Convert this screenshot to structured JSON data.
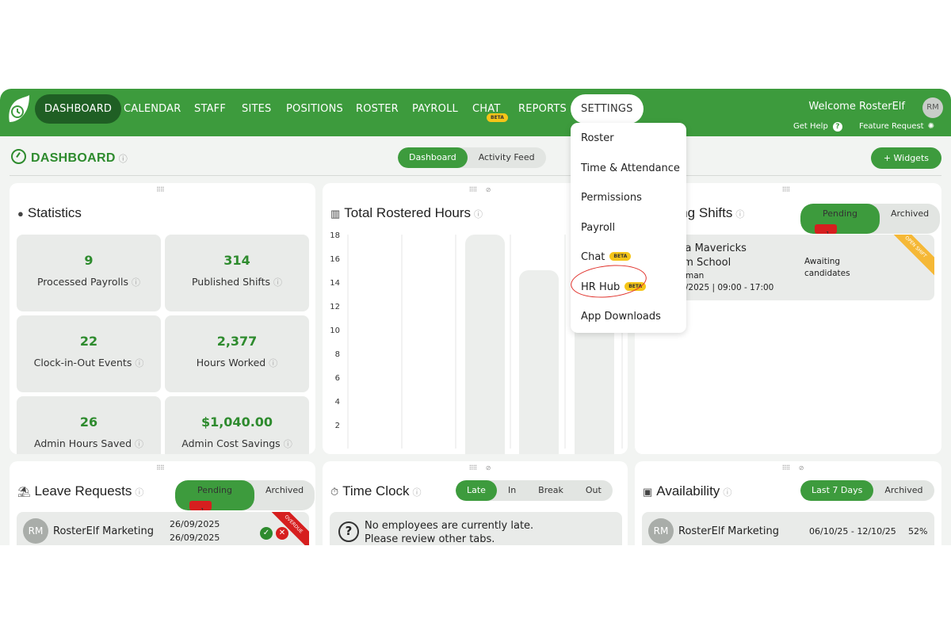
{
  "nav": {
    "items": [
      {
        "label": "DASHBOARD"
      },
      {
        "label": "CALENDAR"
      },
      {
        "label": "STAFF"
      },
      {
        "label": "SITES"
      },
      {
        "label": "POSITIONS"
      },
      {
        "label": "ROSTER"
      },
      {
        "label": "PAYROLL"
      },
      {
        "label": "CHAT"
      },
      {
        "label": "REPORTS"
      },
      {
        "label": "SETTINGS"
      }
    ],
    "chat_badge": "BETA",
    "welcome": "Welcome RosterElf",
    "avatar": "RM",
    "get_help": "Get Help",
    "feature_request": "Feature Request"
  },
  "settings_menu": {
    "items": [
      {
        "label": "Roster"
      },
      {
        "label": "Time & Attendance"
      },
      {
        "label": "Permissions"
      },
      {
        "label": "Payroll"
      },
      {
        "label": "Chat",
        "badge": "BETA"
      },
      {
        "label": "HR Hub",
        "badge": "BETA"
      },
      {
        "label": "App Downloads"
      }
    ]
  },
  "header": {
    "title": "DASHBOARD",
    "tabs": [
      "Dashboard",
      "Activity Feed"
    ],
    "widgets_button": "+ Widgets"
  },
  "statistics": {
    "title": "Statistics",
    "tiles": [
      {
        "value": "9",
        "label": "Processed Payrolls"
      },
      {
        "value": "314",
        "label": "Published Shifts"
      },
      {
        "value": "22",
        "label": "Clock-in-Out Events"
      },
      {
        "value": "2,377",
        "label": "Hours Worked"
      },
      {
        "value": "26",
        "label": "Admin Hours Saved"
      },
      {
        "value": "$1,040.00",
        "label": "Admin Cost Savings"
      }
    ]
  },
  "rostered": {
    "title": "Total Rostered Hours",
    "y_ticks": [
      "18",
      "16",
      "14",
      "12",
      "10",
      "8",
      "6",
      "4",
      "2"
    ]
  },
  "chart_data": {
    "type": "bar",
    "title": "Total Rostered Hours",
    "ylim": [
      0,
      18
    ],
    "values": [
      18,
      15,
      13
    ],
    "grid": true
  },
  "pending_shifts": {
    "title_visible": "ding Shifts",
    "tabs": [
      "Pending",
      "Archived"
    ],
    "pending_count": "1",
    "entry": {
      "line1": "qua Mavericks",
      "line2": "wim School",
      "line3": "oreman",
      "line4": "/11/2025 | 09:00 - 17:00",
      "status": "Awaiting candidates",
      "ribbon": "OPEN SHIFT"
    }
  },
  "leave": {
    "title": "Leave Requests",
    "tabs": [
      "Pending",
      "Archived"
    ],
    "pending_count": "1",
    "row": {
      "avatar": "RM",
      "name": "RosterElf Marketing",
      "date1": "26/09/2025",
      "date2": "26/09/2025",
      "ribbon": "OVERDUE"
    }
  },
  "timeclock": {
    "title": "Time Clock",
    "tabs": [
      "Late",
      "In",
      "Break",
      "Out"
    ],
    "message1": "No employees are currently late.",
    "message2": "Please review other tabs."
  },
  "availability": {
    "title": "Availability",
    "tabs": [
      "Last 7 Days",
      "Archived"
    ],
    "row": {
      "avatar": "RM",
      "name": "RosterElf Marketing",
      "range": "06/10/25 - 12/10/25",
      "pct": "52%"
    }
  },
  "colors": {
    "brand": "#3d9b3d",
    "brand_dark": "#1f5f24",
    "beta": "#f5c518",
    "alert": "#d61f1f"
  }
}
